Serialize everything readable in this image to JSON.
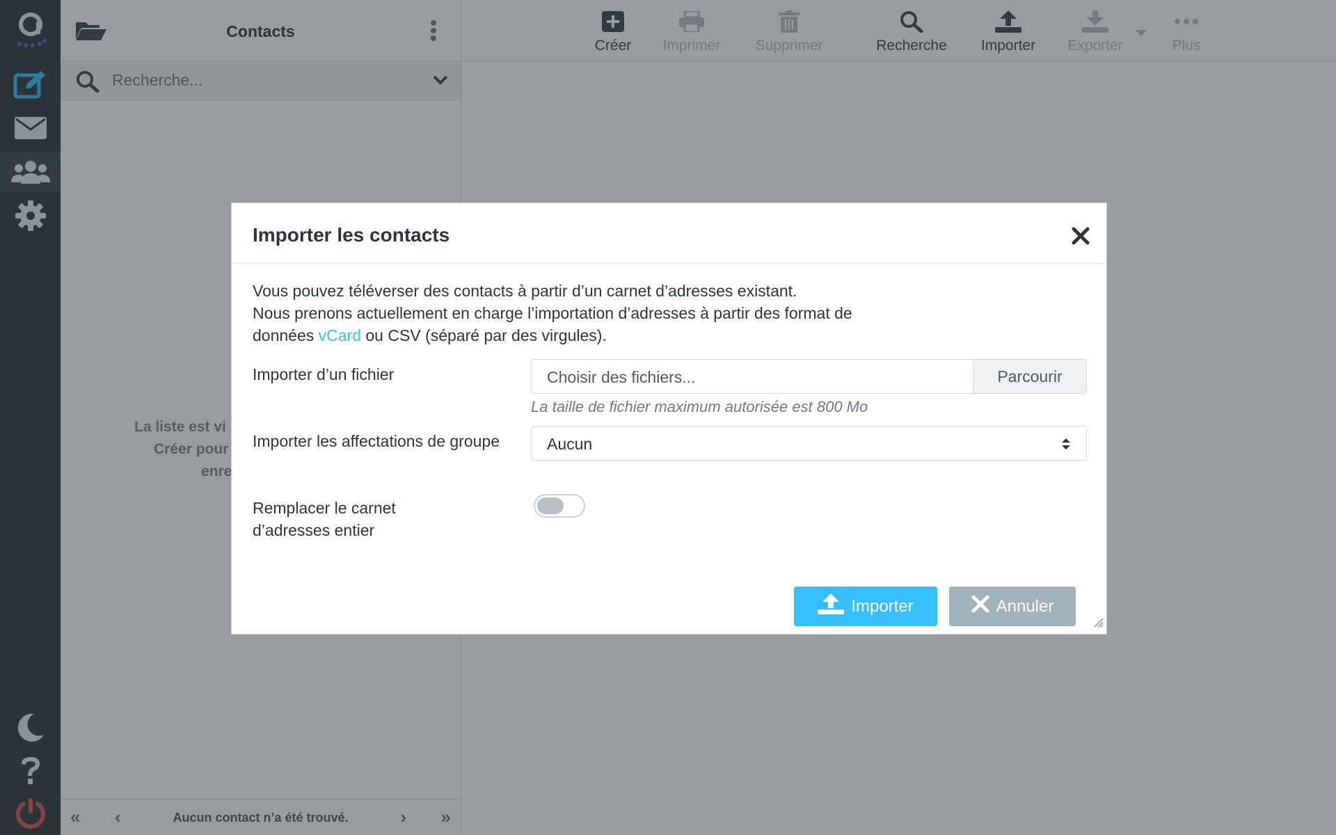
{
  "rail": {
    "icons": [
      "logo-icon",
      "compose-icon",
      "mail-icon",
      "contacts-icon",
      "settings-icon",
      "dark-mode-icon",
      "help-icon",
      "logout-icon"
    ]
  },
  "contacts": {
    "title": "Contacts",
    "search_placeholder": "Recherche...",
    "empty_lines": [
      "La liste est vi",
      "Créer pour",
      "enre"
    ],
    "footer": {
      "first": "«",
      "prev": "‹",
      "count": "Aucun contact n’a été trouvé.",
      "next": "›",
      "last": "»"
    }
  },
  "toolbar": {
    "create": "Créer",
    "print": "Imprimer",
    "delete": "Supprimer",
    "search": "Recherche",
    "import": "Importer",
    "export": "Exporter",
    "more": "Plus"
  },
  "modal": {
    "title": "Importer les contacts",
    "intro_line1": "Vous pouvez téléverser des contacts à partir d’un carnet d’adresses existant.",
    "intro_line2": "Nous prenons actuellement en charge l’importation d’adresses à partir des format de",
    "intro_line3_pre": "données ",
    "intro_link": "vCard",
    "intro_line3_post": " ou CSV (séparé par des virgules).",
    "file_label": "Importer d’un fichier",
    "file_placeholder": "Choisir des fichiers...",
    "browse_label": "Parcourir",
    "file_hint": "La taille de fichier maximum autorisée est 800 Mo",
    "group_label": "Importer les affectations de groupe",
    "group_value": "Aucun",
    "replace_label": "Remplacer le carnet d’adresses entier",
    "replace_enabled": false,
    "import_button": "Importer",
    "cancel_button": "Annuler"
  },
  "colors": {
    "accent": "#37beff",
    "rail_bg": "#2f3a3f",
    "logout": "#d9534f",
    "cancel_bg": "#a3b2b8"
  }
}
